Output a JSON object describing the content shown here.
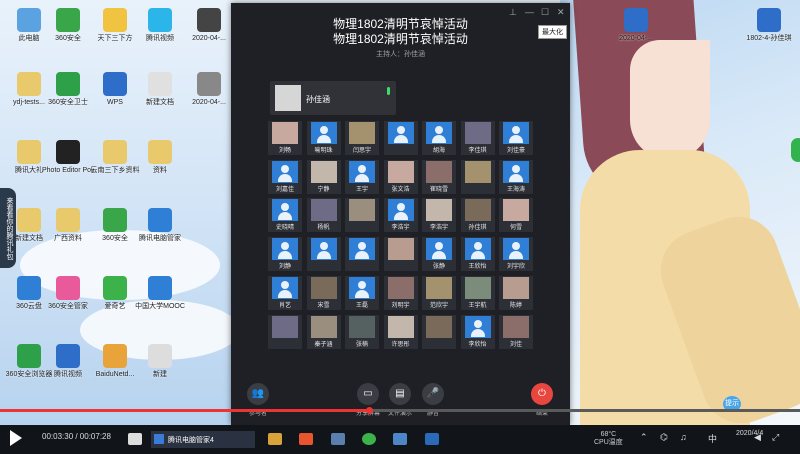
{
  "meeting": {
    "title_line1": "物理1802清明节哀悼活动",
    "title_line2": "物理1802清明节哀悼活动",
    "host": "主持人：孙佳涵",
    "maximize_tip": "最大化",
    "speaker_name": "孙佳涵",
    "participants": [
      "刘畅",
      "喻明珠",
      "闫思宇",
      "",
      "胡海",
      "李佳琪",
      "刘佳豪",
      "刘嘉佳",
      "宁静",
      "王宇",
      "张文浩",
      "崔晓雪",
      "",
      "王海涛",
      "史晓晴",
      "杨帆",
      "",
      "李浩宇",
      "李浩宇",
      "孙佳琪",
      "何雪",
      "刘静",
      "",
      "",
      "",
      "张静",
      "王欣怡",
      "刘宇欣",
      "肖艺",
      "宋雪",
      "王磊",
      "刘明宇",
      "范欣宇",
      "王宇航",
      "陈婷",
      "",
      "秦子涵",
      "张楠",
      "许思彤",
      "",
      "李欣怡",
      "刘佳"
    ],
    "controls": {
      "members": "参与者",
      "share": "分享屏幕",
      "file": "文件演示",
      "mic": "静音",
      "end": "结束"
    }
  },
  "desktop_icons": [
    {
      "label": "此电脑"
    },
    {
      "label": "360安全"
    },
    {
      "label": "天下三下方"
    },
    {
      "label": "腾讯视频"
    },
    {
      "label": "2020-04-..."
    },
    {
      "label": "ydj-tests..."
    },
    {
      "label": "360安全卫士"
    },
    {
      "label": "WPS"
    },
    {
      "label": "新建文档"
    },
    {
      "label": "2020-04-..."
    },
    {
      "label": "腾讯大礼"
    },
    {
      "label": "Photo Editor Polarr"
    },
    {
      "label": "云南三下乡资料"
    },
    {
      "label": "资料"
    },
    {
      "label": "新建文档"
    },
    {
      "label": "广西资料"
    },
    {
      "label": "360安全"
    },
    {
      "label": "腾讯电脑管家"
    },
    {
      "label": "360云盘"
    },
    {
      "label": "360安全管家"
    },
    {
      "label": "爱奇艺"
    },
    {
      "label": "中国大学MOOC"
    },
    {
      "label": "360安全浏览器"
    },
    {
      "label": "腾讯视频"
    },
    {
      "label": "BaiduNetd..."
    },
    {
      "label": "新建"
    },
    {
      "label": "2020-04-..."
    },
    {
      "label": "1802-4-孙佳琪"
    }
  ],
  "side_strip": "来看看你的腾讯礼包",
  "player": {
    "time": "00:03:30 / 00:07:28",
    "progress": 0.463
  },
  "taskbar": {
    "active_app": "腾讯电脑管家4",
    "weather_temp": "68°C",
    "weather_label": "CPU温度",
    "ime": "中",
    "clock_time": "",
    "clock_date": "2020/4/4"
  },
  "bubble": "提示",
  "colors": {
    "accent": "#2f7fd6",
    "end": "#e8463f",
    "progress": "#e33333"
  }
}
